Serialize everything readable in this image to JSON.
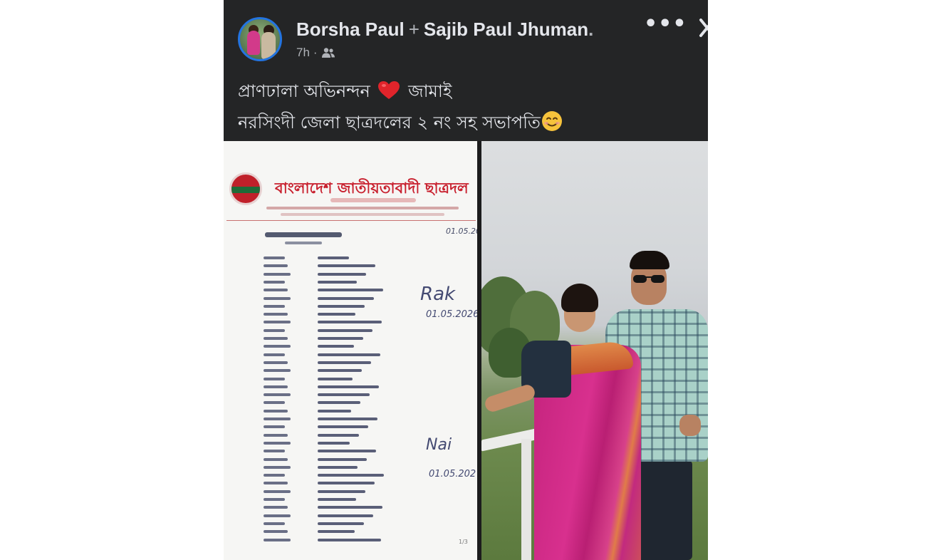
{
  "post": {
    "author_primary": "Borsha Paul",
    "with_separator": "+",
    "author_secondary": "Sajib Paul Jhuman",
    "trailing_dot": ".",
    "timestamp": "7h",
    "meta_separator": "·",
    "audience_icon": "friends-icon",
    "more_icon": "more-horizontal-icon",
    "more_label": "•••",
    "close_icon": "close-icon",
    "caption_line1": "প্রাণঢালা অভিনন্দন",
    "caption_line1_emoji": "red-heart",
    "caption_line1_end": "জামাই",
    "caption_line2": "নরসিংদী জেলা ছাত্রদলের ২ নং সহ সভাপতি",
    "caption_line2_emoji": "smiling-face",
    "colors": {
      "background": "#242526",
      "text": "#e4e6eb",
      "secondary": "#b0b3b8",
      "avatar_ring": "#2374e1"
    }
  },
  "photos": {
    "document": {
      "org_title": "বাংলাদেশ জাতীয়তাবাদী ছাত্রদল",
      "date_top": "01.05.20",
      "signature1": "Rak",
      "signature1_date": "01.05.2026",
      "signature2": "Nai",
      "signature2_date": "01.05.202",
      "page_number": "1/3",
      "accent_color": "#c8202e"
    },
    "couple_photo_description_icon": "photo-icon"
  }
}
